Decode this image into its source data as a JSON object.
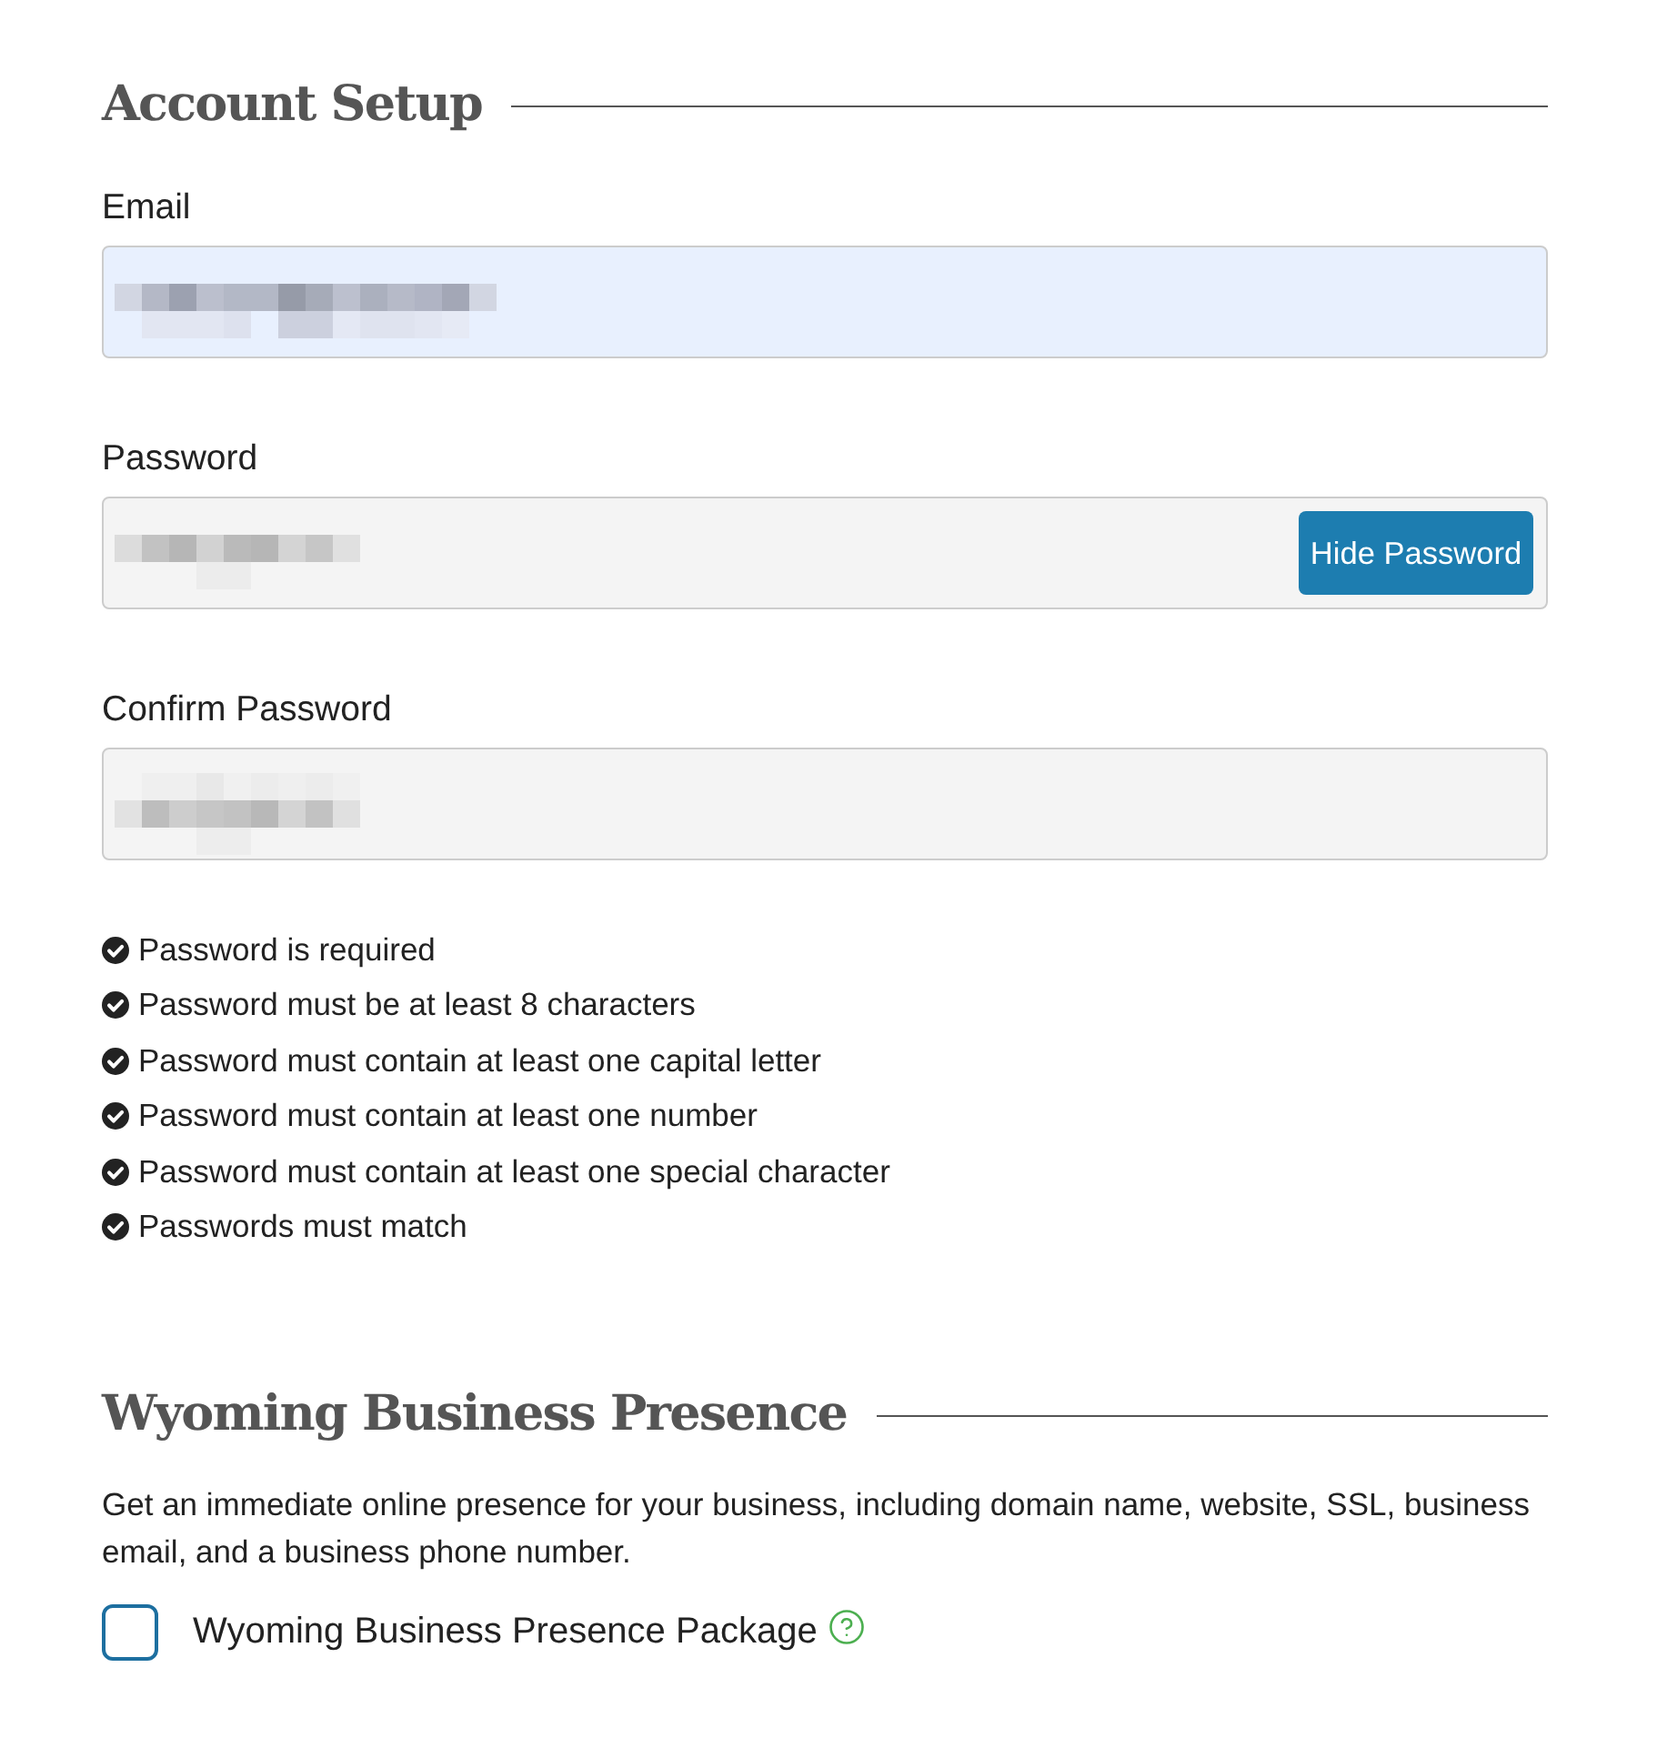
{
  "account_setup": {
    "heading": "Account Setup",
    "fields": [
      {
        "label": "Email",
        "redacted": true,
        "autofilled": true
      },
      {
        "label": "Password",
        "redacted": true,
        "autofilled": false,
        "button": "Hide Password"
      },
      {
        "label": "Confirm Password",
        "redacted": true,
        "autofilled": false
      }
    ],
    "requirements": [
      {
        "text": "Password is required",
        "met": true
      },
      {
        "text": "Password must be at least 8 characters",
        "met": true
      },
      {
        "text": "Password must contain at least one capital letter",
        "met": true
      },
      {
        "text": "Password must contain at least one number",
        "met": true
      },
      {
        "text": "Password must contain at least one special character",
        "met": true
      },
      {
        "text": "Passwords must match",
        "met": true
      }
    ]
  },
  "business_presence": {
    "heading": "Wyoming Business Presence",
    "description": "Get an immediate online presence for your business, including domain name, website, SSL, business email, and a business phone number.",
    "option": {
      "label": "Wyoming Business Presence Package",
      "checked": false,
      "help": true
    }
  }
}
